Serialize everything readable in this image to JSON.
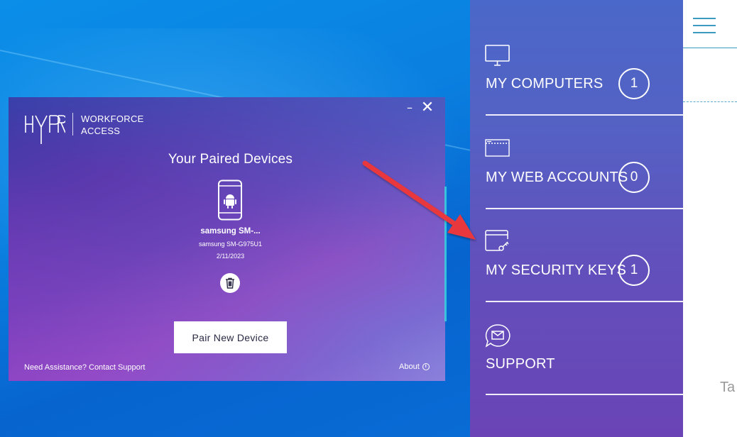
{
  "hypr": {
    "brand_line1": "WORKFORCE",
    "brand_line2": "ACCESS",
    "minimize": "–",
    "close": "✕",
    "title": "Your Paired Devices",
    "device": {
      "name": "samsung SM-...",
      "model": "samsung SM-G975U1",
      "date": "2/11/2023"
    },
    "pair_button": "Pair New Device",
    "footer": {
      "need_assistance": "Need Assistance?",
      "contact_support": "Contact Support",
      "about": "About",
      "info_glyph": "i"
    }
  },
  "sidebar": {
    "items": [
      {
        "label": "MY COMPUTERS",
        "count": "1",
        "icon": "monitor-icon"
      },
      {
        "label": "MY WEB ACCOUNTS",
        "count": "0",
        "icon": "browser-window-icon"
      },
      {
        "label": "MY SECURITY KEYS",
        "count": "1",
        "icon": "security-key-icon"
      },
      {
        "label": "SUPPORT",
        "icon": "chat-mail-icon"
      }
    ]
  },
  "content": {
    "partial_text": "Ta"
  },
  "colors": {
    "annotation_arrow": "#e8383d",
    "teal_accent": "#3a9cc4"
  }
}
